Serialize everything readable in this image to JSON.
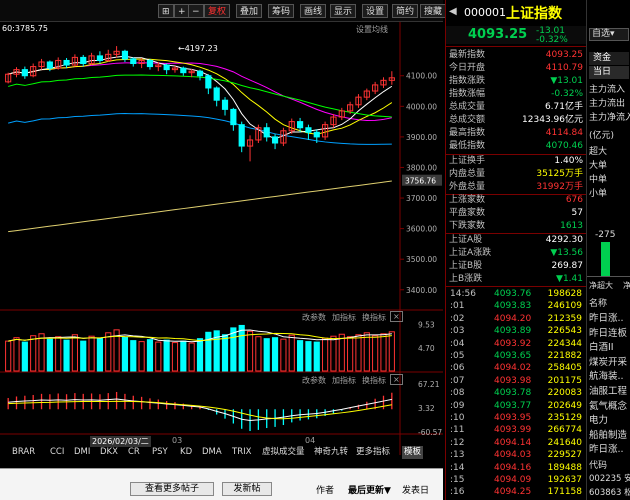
{
  "toolbar": {
    "pin_icon": "pin-icon",
    "buttons": [
      "+",
      "−",
      "复权",
      "叠加",
      "筹码",
      "画线",
      "显示",
      "设置",
      "简约",
      "搜藏"
    ],
    "active": "复权"
  },
  "chart": {
    "ma_prefix": "60:3785.75",
    "settings_label": "设置均线",
    "high_marker": "4197.23",
    "price_ticks": [
      "4100.00",
      "4000.00",
      "3900.00",
      "3800.00",
      "3700.00",
      "3600.00",
      "3500.00",
      "3400.00"
    ],
    "last_price_tag": "3756.76",
    "volume_toolbar": [
      "改参数",
      "加指标",
      "换指标"
    ],
    "volume_ticks": [
      "9.53",
      "4.70"
    ],
    "macd_toolbar": [
      "改参数",
      "加指标",
      "换指标"
    ],
    "macd_ticks": [
      "67.21",
      "3.32",
      "-60.57"
    ],
    "date_cursor": "2026/02/03/二",
    "x_labels": [
      "03",
      "04"
    ],
    "indicator_tabs": [
      "BRAR",
      "CCI",
      "DMI",
      "DKX",
      "CR",
      "PSY",
      "KD",
      "DMA",
      "TRIX",
      "虚拟成交量",
      "神奇九转",
      "更多指标"
    ],
    "template_tab": "模板",
    "candles": [
      {
        "o": 4080,
        "c": 4105,
        "h": 4110,
        "l": 4075
      },
      {
        "o": 4105,
        "c": 4120,
        "h": 4128,
        "l": 4095
      },
      {
        "o": 4120,
        "c": 4100,
        "h": 4130,
        "l": 4090
      },
      {
        "o": 4100,
        "c": 4130,
        "h": 4140,
        "l": 4095
      },
      {
        "o": 4130,
        "c": 4145,
        "h": 4155,
        "l": 4120
      },
      {
        "o": 4145,
        "c": 4125,
        "h": 4150,
        "l": 4115
      },
      {
        "o": 4125,
        "c": 4150,
        "h": 4160,
        "l": 4120
      },
      {
        "o": 4150,
        "c": 4135,
        "h": 4158,
        "l": 4125
      },
      {
        "o": 4135,
        "c": 4160,
        "h": 4170,
        "l": 4130
      },
      {
        "o": 4160,
        "c": 4140,
        "h": 4168,
        "l": 4130
      },
      {
        "o": 4140,
        "c": 4165,
        "h": 4175,
        "l": 4135
      },
      {
        "o": 4165,
        "c": 4150,
        "h": 4180,
        "l": 4140
      },
      {
        "o": 4150,
        "c": 4170,
        "h": 4185,
        "l": 4145
      },
      {
        "o": 4170,
        "c": 4180,
        "h": 4197,
        "l": 4160
      },
      {
        "o": 4180,
        "c": 4155,
        "h": 4185,
        "l": 4145
      },
      {
        "o": 4155,
        "c": 4140,
        "h": 4160,
        "l": 4130
      },
      {
        "o": 4140,
        "c": 4150,
        "h": 4158,
        "l": 4125
      },
      {
        "o": 4150,
        "c": 4130,
        "h": 4155,
        "l": 4120
      },
      {
        "o": 4130,
        "c": 4135,
        "h": 4145,
        "l": 4115
      },
      {
        "o": 4135,
        "c": 4120,
        "h": 4140,
        "l": 4105
      },
      {
        "o": 4120,
        "c": 4125,
        "h": 4132,
        "l": 4110
      },
      {
        "o": 4125,
        "c": 4110,
        "h": 4130,
        "l": 4100
      },
      {
        "o": 4110,
        "c": 4115,
        "h": 4122,
        "l": 4095
      },
      {
        "o": 4115,
        "c": 4100,
        "h": 4120,
        "l": 4085
      },
      {
        "o": 4100,
        "c": 4060,
        "h": 4105,
        "l": 4040
      },
      {
        "o": 4060,
        "c": 4020,
        "h": 4065,
        "l": 4000
      },
      {
        "o": 4020,
        "c": 3990,
        "h": 4030,
        "l": 3970
      },
      {
        "o": 3990,
        "c": 3940,
        "h": 3995,
        "l": 3920
      },
      {
        "o": 3940,
        "c": 3870,
        "h": 3950,
        "l": 3850
      },
      {
        "o": 3870,
        "c": 3890,
        "h": 3905,
        "l": 3820
      },
      {
        "o": 3890,
        "c": 3930,
        "h": 3940,
        "l": 3880
      },
      {
        "o": 3930,
        "c": 3900,
        "h": 3945,
        "l": 3885
      },
      {
        "o": 3900,
        "c": 3880,
        "h": 3910,
        "l": 3860
      },
      {
        "o": 3880,
        "c": 3920,
        "h": 3930,
        "l": 3870
      },
      {
        "o": 3920,
        "c": 3950,
        "h": 3960,
        "l": 3910
      },
      {
        "o": 3950,
        "c": 3930,
        "h": 3962,
        "l": 3915
      },
      {
        "o": 3930,
        "c": 3915,
        "h": 3940,
        "l": 3890
      },
      {
        "o": 3915,
        "c": 3900,
        "h": 3925,
        "l": 3880
      },
      {
        "o": 3900,
        "c": 3940,
        "h": 3950,
        "l": 3890
      },
      {
        "o": 3940,
        "c": 3965,
        "h": 3975,
        "l": 3930
      },
      {
        "o": 3965,
        "c": 3985,
        "h": 3995,
        "l": 3955
      },
      {
        "o": 3985,
        "c": 4005,
        "h": 4015,
        "l": 3975
      },
      {
        "o": 4005,
        "c": 4030,
        "h": 4040,
        "l": 3995
      },
      {
        "o": 4030,
        "c": 4050,
        "h": 4058,
        "l": 4020
      },
      {
        "o": 4050,
        "c": 4070,
        "h": 4080,
        "l": 4040
      },
      {
        "o": 4070,
        "c": 4085,
        "h": 4095,
        "l": 4060
      },
      {
        "o": 4085,
        "c": 4093.25,
        "h": 4114.84,
        "l": 4070.46
      }
    ],
    "volumes": [
      6.1,
      6.8,
      5.9,
      7.2,
      7.6,
      6.5,
      7.0,
      6.3,
      7.4,
      6.1,
      7.1,
      6.6,
      7.8,
      8.4,
      6.9,
      6.2,
      6.0,
      6.4,
      5.9,
      6.3,
      5.8,
      6.1,
      5.7,
      6.6,
      7.9,
      8.2,
      7.4,
      8.8,
      9.3,
      8.1,
      7.0,
      6.6,
      6.8,
      6.5,
      7.3,
      6.2,
      6.0,
      5.9,
      6.7,
      7.1,
      7.5,
      7.0,
      7.4,
      7.8,
      7.2,
      7.6,
      8.0
    ],
    "macd": [
      30,
      34,
      36,
      38,
      41,
      40,
      42,
      40,
      43,
      41,
      42,
      40,
      43,
      46,
      41,
      36,
      33,
      29,
      26,
      22,
      19,
      15,
      11,
      7,
      -2,
      -14,
      -25,
      -38,
      -52,
      -58,
      -55,
      -50,
      -47,
      -42,
      -35,
      -30,
      -27,
      -24,
      -18,
      -11,
      -4,
      4,
      12,
      20,
      28,
      36,
      44
    ]
  },
  "quote": {
    "code": "000001",
    "name": "上证指数",
    "price": "4093.25",
    "change": "-13.01",
    "change_pct": "-0.32%",
    "fields": [
      {
        "label": "最新指数",
        "value": "4093.25",
        "color": "red"
      },
      {
        "label": "今日开盘",
        "value": "4110.79",
        "color": "red"
      },
      {
        "label": "指数涨跌",
        "value": "▼13.01",
        "color": "green"
      },
      {
        "label": "指数涨幅",
        "value": "-0.32%",
        "color": "green"
      },
      {
        "label": "总成交量",
        "value": "6.71亿手",
        "color": "white"
      },
      {
        "label": "总成交额",
        "value": "12343.96亿元",
        "color": "white"
      },
      {
        "label": "最高指数",
        "value": "4114.84",
        "color": "red"
      },
      {
        "label": "最低指数",
        "value": "4070.46",
        "color": "green"
      }
    ],
    "fields2": [
      {
        "label": "上证换手",
        "value": "1.40%",
        "color": "white"
      },
      {
        "label": "内盘总量",
        "value": "35125万手",
        "color": "yellow"
      },
      {
        "label": "外盘总量",
        "value": "31992万手",
        "color": "red"
      }
    ],
    "fields3": [
      {
        "label": "上涨家数",
        "value": "676",
        "color": "red"
      },
      {
        "label": "平盘家数",
        "value": "57",
        "color": "white"
      },
      {
        "label": "下跌家数",
        "value": "1613",
        "color": "green"
      }
    ],
    "fields4": [
      {
        "label": "上证A股",
        "value": "4292.30",
        "color": "white"
      },
      {
        "label": "上证A涨跌",
        "value": "▼13.56",
        "color": "green"
      },
      {
        "label": "上证B股",
        "value": "269.87",
        "color": "white"
      },
      {
        "label": "上B涨跌",
        "value": "▼1.41",
        "color": "green"
      }
    ]
  },
  "ticks": [
    {
      "time": "14:56",
      "price": "4093.76",
      "vol": "198628"
    },
    {
      "time": ":01",
      "price": "4093.83",
      "vol": "246109"
    },
    {
      "time": ":02",
      "price": "4094.20",
      "vol": "212359"
    },
    {
      "time": ":03",
      "price": "4093.89",
      "vol": "226543"
    },
    {
      "time": ":04",
      "price": "4093.92",
      "vol": "224344"
    },
    {
      "time": ":05",
      "price": "4093.65",
      "vol": "221882"
    },
    {
      "time": ":06",
      "price": "4094.02",
      "vol": "258405"
    },
    {
      "time": ":07",
      "price": "4093.98",
      "vol": "201175"
    },
    {
      "time": ":08",
      "price": "4093.78",
      "vol": "220083"
    },
    {
      "time": ":09",
      "price": "4093.77",
      "vol": "202649"
    },
    {
      "time": ":10",
      "price": "4093.95",
      "vol": "235129"
    },
    {
      "time": ":11",
      "price": "4093.99",
      "vol": "266774"
    },
    {
      "time": ":12",
      "price": "4094.14",
      "vol": "241640"
    },
    {
      "time": ":13",
      "price": "4094.03",
      "vol": "229527"
    },
    {
      "time": ":14",
      "price": "4094.16",
      "vol": "189488"
    },
    {
      "time": ":15",
      "price": "4094.09",
      "vol": "192637"
    },
    {
      "time": ":16",
      "price": "4094.25",
      "vol": "171158"
    }
  ],
  "side": {
    "dropdown": "自选",
    "tabs": [
      "资金",
      "当日"
    ],
    "flows": [
      "主力流入",
      "主力流出",
      "主力净流入"
    ],
    "unit": "(亿元)",
    "sizes": [
      "超大",
      "大单",
      "中单",
      "小单"
    ],
    "bar_value": "-275",
    "bar_labels": [
      "净超大",
      "净"
    ],
    "news_header": "名称",
    "news": [
      "昨日涨..",
      "昨日连板",
      "白酒II",
      "煤炭开采",
      "航海装..",
      "油服工程",
      "氦气概念",
      "电力",
      "船舶制造",
      "昨日涨.."
    ],
    "code_header": "代码",
    "codes": [
      "002235 安",
      "603863 松"
    ]
  },
  "footer": {
    "view_more": "查看更多帖子",
    "post": "发新帖",
    "author": "作者",
    "latest": "最后更新",
    "publish": "发表日"
  },
  "colors": {
    "up": "#ff3333",
    "down": "#00ffff",
    "down_green": "#00d050",
    "ma5": "#ffffff",
    "ma10": "#ffff00",
    "ma20": "#ff00ff",
    "ma60": "#00ff00"
  }
}
